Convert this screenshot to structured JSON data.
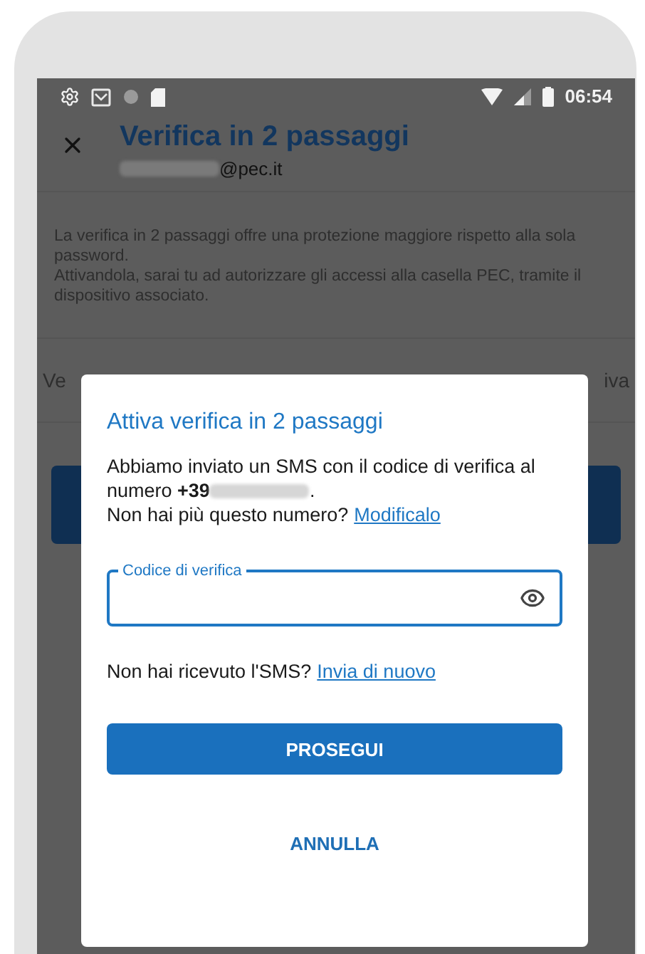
{
  "status_bar": {
    "time": "06:54"
  },
  "app_bar": {
    "title": "Verifica in 2 passaggi",
    "subtitle": "@pec.it"
  },
  "background": {
    "description": [
      "La verifica in 2 passaggi offre una protezione maggiore rispetto alla sola password.",
      "Attivandola, sarai tu ad autorizzare gli accessi alla casella PEC, tramite il dispositivo associato."
    ],
    "row_left": "Ve",
    "row_right": "iva"
  },
  "dialog": {
    "title": "Attiva verifica in 2 passaggi",
    "message_start": "Abbiamo inviato un SMS con il codice di verifica al numero **+39**",
    "message_end": ".",
    "change_prompt": "Non hai più questo numero?",
    "change_link": "Modificalo",
    "field": {
      "label": "Codice di verifica",
      "focused": true
    },
    "resend_prompt": "Non hai ricevuto l'SMS?",
    "resend_link": "Invia di nuovo",
    "primary_button": "PROSEGUI",
    "secondary_button": "ANNULLA"
  }
}
